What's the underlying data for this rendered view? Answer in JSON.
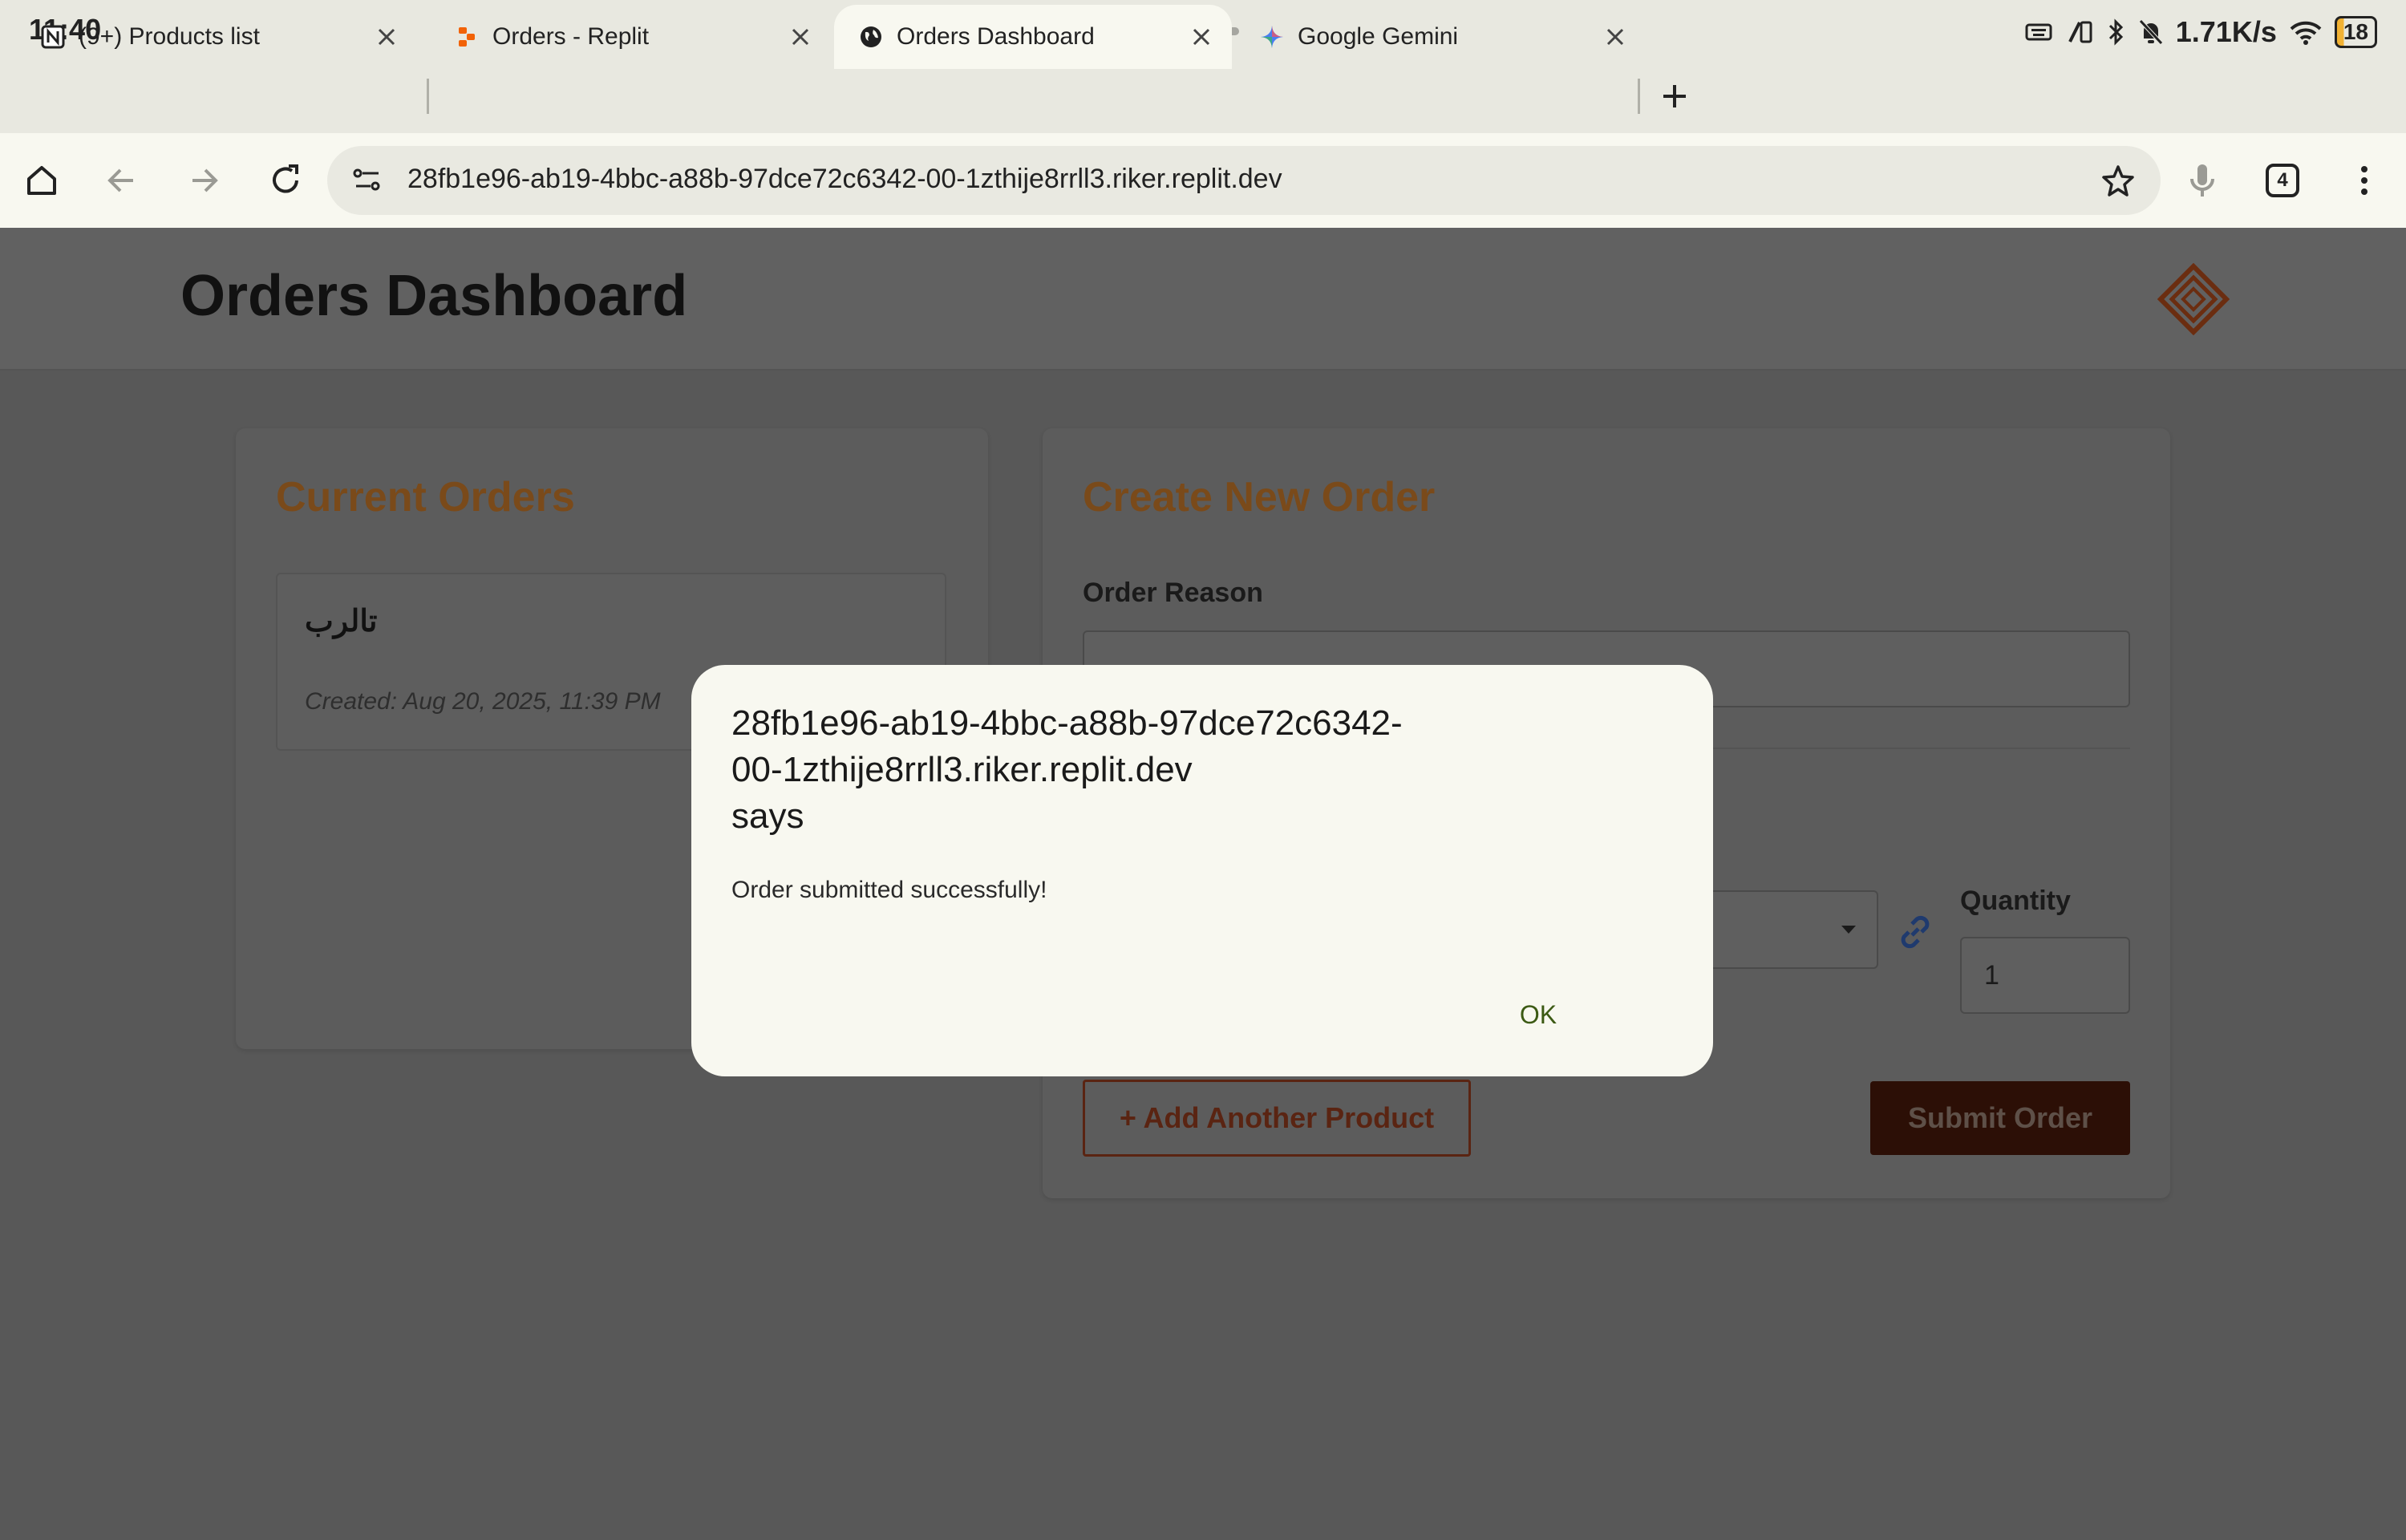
{
  "status_bar": {
    "time": "11:40",
    "net_speed": "1.71K/s",
    "battery": "18"
  },
  "tabs": [
    {
      "title": "(9+) Products list",
      "icon": "notion-icon"
    },
    {
      "title": "Orders - Replit",
      "icon": "replit-icon"
    },
    {
      "title": "Orders Dashboard",
      "icon": "globe-icon"
    },
    {
      "title": "Google Gemini",
      "icon": "gemini-icon"
    }
  ],
  "toolbar": {
    "url": "28fb1e96-ab19-4bbc-a88b-97dce72c6342-00-1zthije8rrll3.riker.replit.dev",
    "tab_count": "4"
  },
  "page": {
    "title": "Orders Dashboard",
    "current_orders": {
      "heading": "Current Orders",
      "items": [
        {
          "name": "تالرب",
          "created": "Created: Aug 20, 2025, 11:39 PM"
        }
      ]
    },
    "create_order": {
      "heading": "Create New Order",
      "reason_label": "Order Reason",
      "quantity_label": "Quantity",
      "quantity_value": "1",
      "add_product_label": "+ Add Another Product",
      "submit_label": "Submit Order"
    }
  },
  "dialog": {
    "title": "28fb1e96-ab19-4bbc-a88b-97dce72c6342-00-1zthije8rrll3.riker.replit.dev",
    "says": "says",
    "message": "Order submitted successfully!",
    "ok_label": "OK"
  },
  "colors": {
    "accent": "#c06a1f",
    "submit": "#6e2610",
    "dialog_bg": "#f8f8f0"
  }
}
